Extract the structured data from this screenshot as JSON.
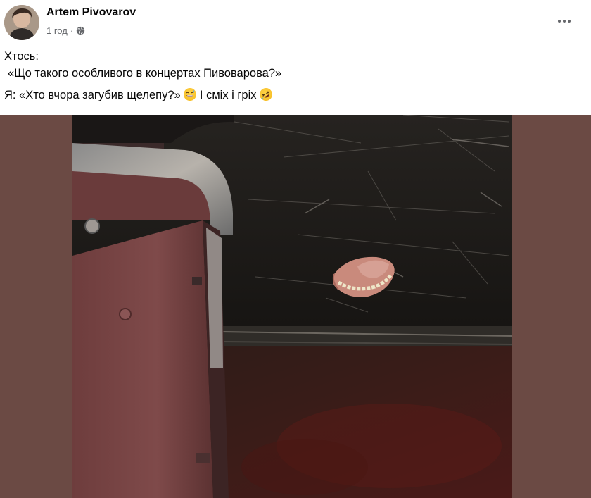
{
  "post": {
    "author": "Artem Pivovarov",
    "time": "1 год",
    "separator": "·",
    "privacy_icon": "globe-icon",
    "more_icon": "more-horizontal-icon",
    "text": {
      "line1": "Хтось:",
      "line2": "«Що такого особливого в концертах Пивоварова?»",
      "line3_part1": "Я: «Хто вчора загубив щелепу?»",
      "line3_emoji1": "grinning-sweat-emoji",
      "line3_part2": "І сміх і гріх",
      "line3_emoji2": "rolling-on-floor-laughing-emoji"
    },
    "photo": {
      "description_icon": "post-photo",
      "background_color": "#6b4a44"
    }
  }
}
